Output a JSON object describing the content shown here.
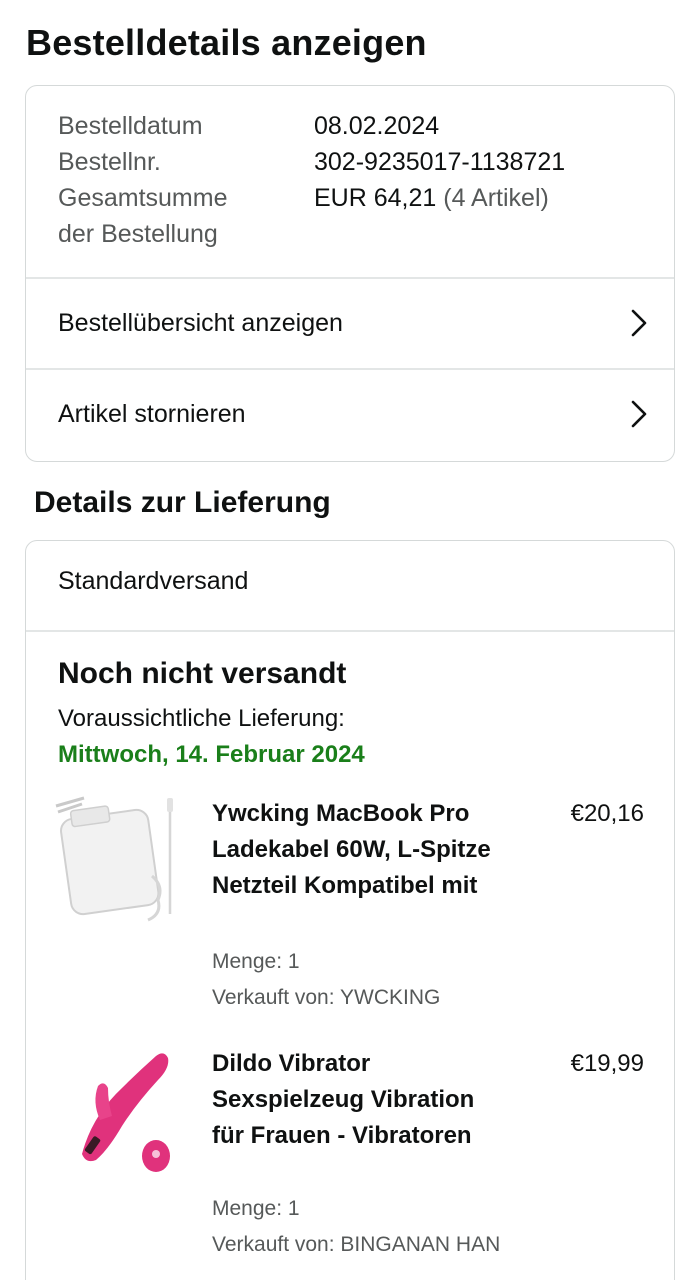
{
  "page_title": "Bestelldetails anzeigen",
  "summary": {
    "rows": [
      {
        "label": "Bestelldatum",
        "value": "08.02.2024"
      },
      {
        "label": "Bestellnr.",
        "value": "302-9235017-1138721"
      },
      {
        "label": "Gesamtsumme",
        "value": "EUR 64,21",
        "value_extra": "(4 Artikel)"
      },
      {
        "label": "der Bestellung",
        "value": ""
      }
    ],
    "links": [
      {
        "label": "Bestellübersicht anzeigen"
      },
      {
        "label": "Artikel stornieren"
      }
    ]
  },
  "delivery": {
    "section_title": "Details zur Lieferung",
    "shipping_method": "Standardversand",
    "status": "Noch nicht versandt",
    "expected_label": "Voraussichtliche Lieferung:",
    "expected_date": "Mittwoch, 14. Februar 2024",
    "items": [
      {
        "title": "Ywcking MacBook Pro Ladekabel 60W, L-Spitze Netzteil Kompatibel mit",
        "price": "€20,16",
        "quantity": "Menge: 1",
        "seller": "Verkauft von: YWCKING",
        "image_icon": "power-adapter-image"
      },
      {
        "title": "Dildo Vibrator Sexspielzeug Vibration für Frauen - Vibratoren",
        "price": "€19,99",
        "quantity": "Menge: 1",
        "seller": "Verkauft von: BINGANAN HAN",
        "image_icon": "pink-device-image"
      }
    ]
  },
  "colors": {
    "delivery_date": "#1a7f1a",
    "muted_text": "#565959",
    "border": "#d5d9d9"
  }
}
